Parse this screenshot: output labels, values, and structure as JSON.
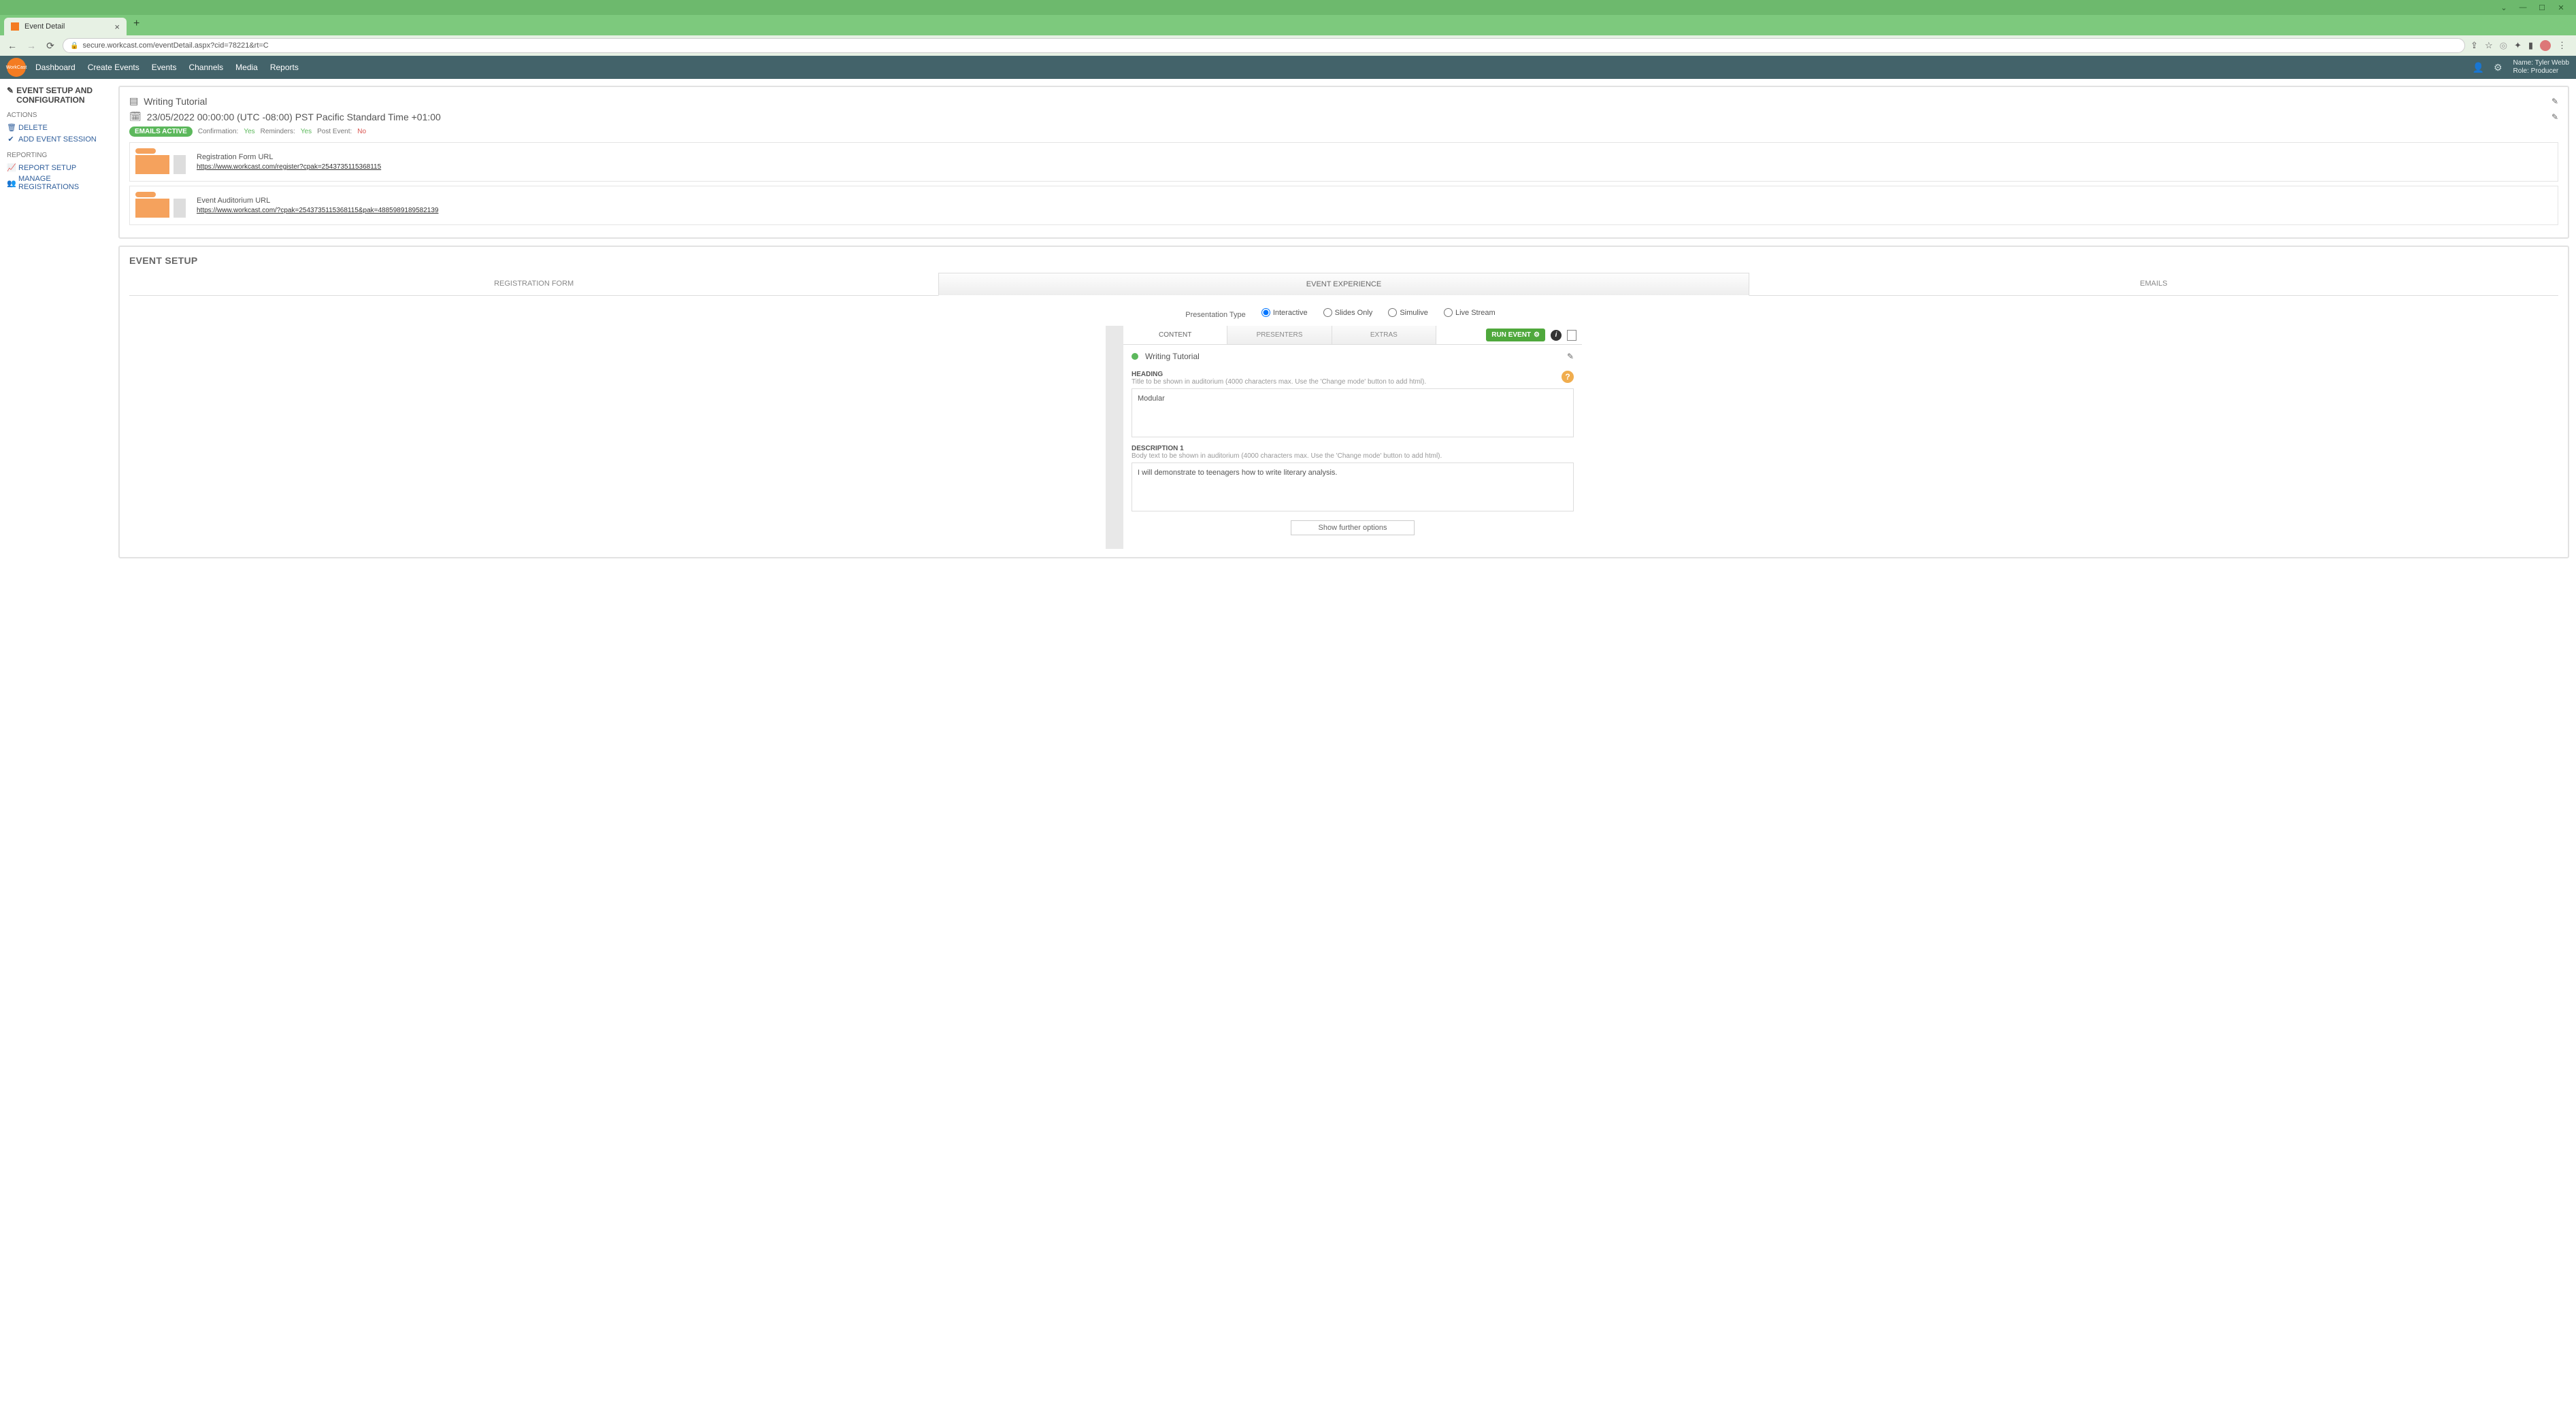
{
  "browser": {
    "tab_title": "Event Detail",
    "url": "secure.workcast.com/eventDetail.aspx?cid=78221&rt=C"
  },
  "nav": {
    "logo_text": "WorkCast",
    "links": [
      "Dashboard",
      "Create Events",
      "Events",
      "Channels",
      "Media",
      "Reports"
    ],
    "user_name_label": "Name: Tyler Webb",
    "user_role_label": "Role: Producer"
  },
  "sidebar": {
    "title": "EVENT SETUP AND CONFIGURATION",
    "actions_label": "ACTIONS",
    "delete_label": "DELETE",
    "add_session_label": "ADD EVENT SESSION",
    "reporting_label": "REPORTING",
    "report_setup_label": "REPORT SETUP",
    "manage_reg_label": "MANAGE REGISTRATIONS"
  },
  "header": {
    "event_title": "Writing Tutorial",
    "event_datetime": "23/05/2022 00:00:00 (UTC -08:00) PST Pacific Standard Time +01:00",
    "emails_badge": "EMAILS ACTIVE",
    "confirmation_label": "Confirmation:",
    "confirmation_value": "Yes",
    "reminders_label": "Reminders:",
    "reminders_value": "Yes",
    "postevent_label": "Post Event:",
    "postevent_value": "No",
    "reg_url_label": "Registration Form URL",
    "reg_url": "https://www.workcast.com/register?cpak=2543735115368115",
    "aud_url_label": "Event Auditorium URL",
    "aud_url": "https://www.workcast.com/?cpak=2543735115368115&pak=4885989189582139"
  },
  "setup": {
    "title": "EVENT SETUP",
    "tabs": {
      "registration": "REGISTRATION FORM",
      "experience": "EVENT EXPERIENCE",
      "emails": "EMAILS"
    },
    "presentation_type_label": "Presentation Type",
    "radios": {
      "interactive": "Interactive",
      "slides": "Slides Only",
      "simulive": "Simulive",
      "live": "Live Stream"
    },
    "subtabs": {
      "content": "CONTENT",
      "presenters": "PRESENTERS",
      "extras": "EXTRAS"
    },
    "run_event_label": "RUN EVENT",
    "session_name": "Writing Tutorial",
    "heading_label": "HEADING",
    "heading_hint": "Title to be shown in auditorium (4000 characters max. Use the 'Change mode' button to add html).",
    "heading_value": "Modular",
    "desc_label": "DESCRIPTION 1",
    "desc_hint": "Body text to be shown in auditorium (4000 characters max. Use the 'Change mode' button to add html).",
    "desc_value": "I will demonstrate to teenagers how to write literary analysis.",
    "show_more_label": "Show further options"
  }
}
